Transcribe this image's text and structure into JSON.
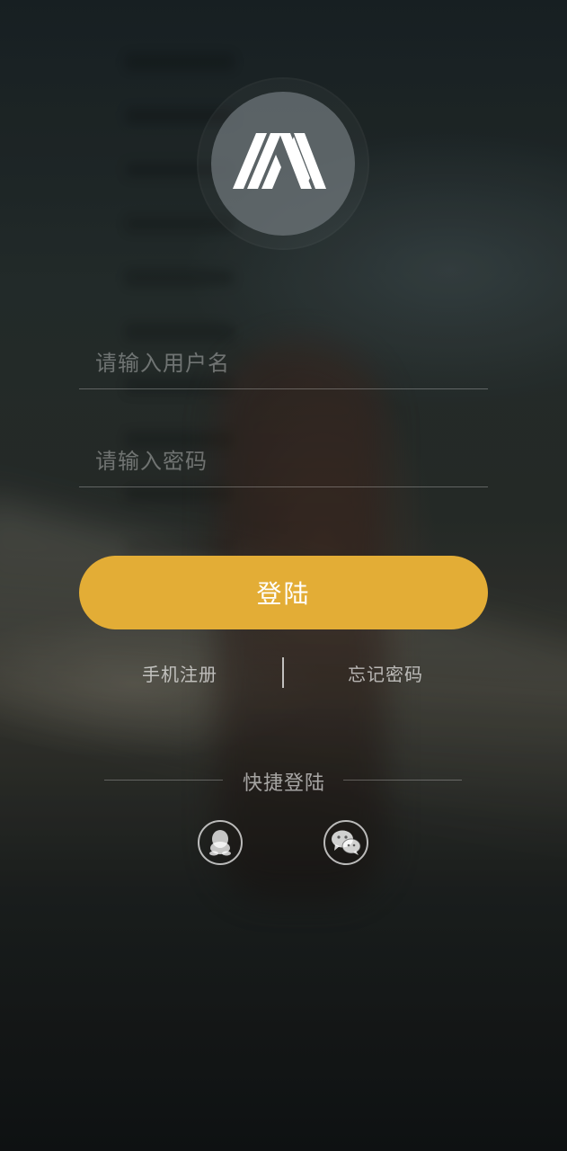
{
  "logo": {
    "icon": "m-logo-icon"
  },
  "form": {
    "username_placeholder": "请输入用户名",
    "password_placeholder": "请输入密码"
  },
  "login_button_label": "登陆",
  "links": {
    "register": "手机注册",
    "forgot_password": "忘记密码"
  },
  "quick_login": {
    "title": "快捷登陆",
    "providers": [
      {
        "icon": "qq-icon"
      },
      {
        "icon": "wechat-icon"
      }
    ]
  },
  "colors": {
    "accent": "#e3ad36"
  }
}
